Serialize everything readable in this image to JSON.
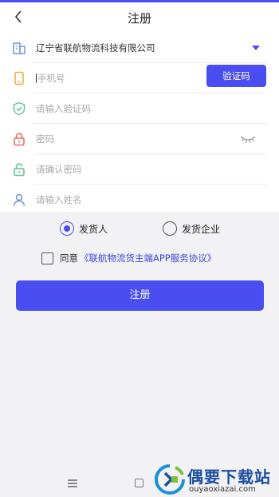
{
  "header": {
    "title": "注册"
  },
  "form": {
    "company": "辽宁省联航物流科技有限公司",
    "phone_placeholder": "手机号",
    "code_button": "验证码",
    "code_placeholder": "请输入验证码",
    "password_placeholder": "密码",
    "confirm_placeholder": "请确认密码",
    "name_placeholder": "请输入姓名"
  },
  "roles": {
    "shipper": "发货人",
    "enterprise": "发货企业",
    "selected": "shipper"
  },
  "agreement": {
    "prefix": "同意",
    "link": "《联航物流货主端APP服务协议》"
  },
  "register_button": "注册",
  "watermark": {
    "title": "偶要下载站",
    "url": "ouyaoxiazai.com"
  },
  "colors": {
    "accent": "#4a4ef0",
    "link": "#3d44e0"
  },
  "icons": [
    "back-icon",
    "building-icon",
    "phone-icon",
    "shield-icon",
    "lock-icon",
    "lock-open-icon",
    "user-icon",
    "eye-closed-icon",
    "dropdown-caret-icon"
  ]
}
